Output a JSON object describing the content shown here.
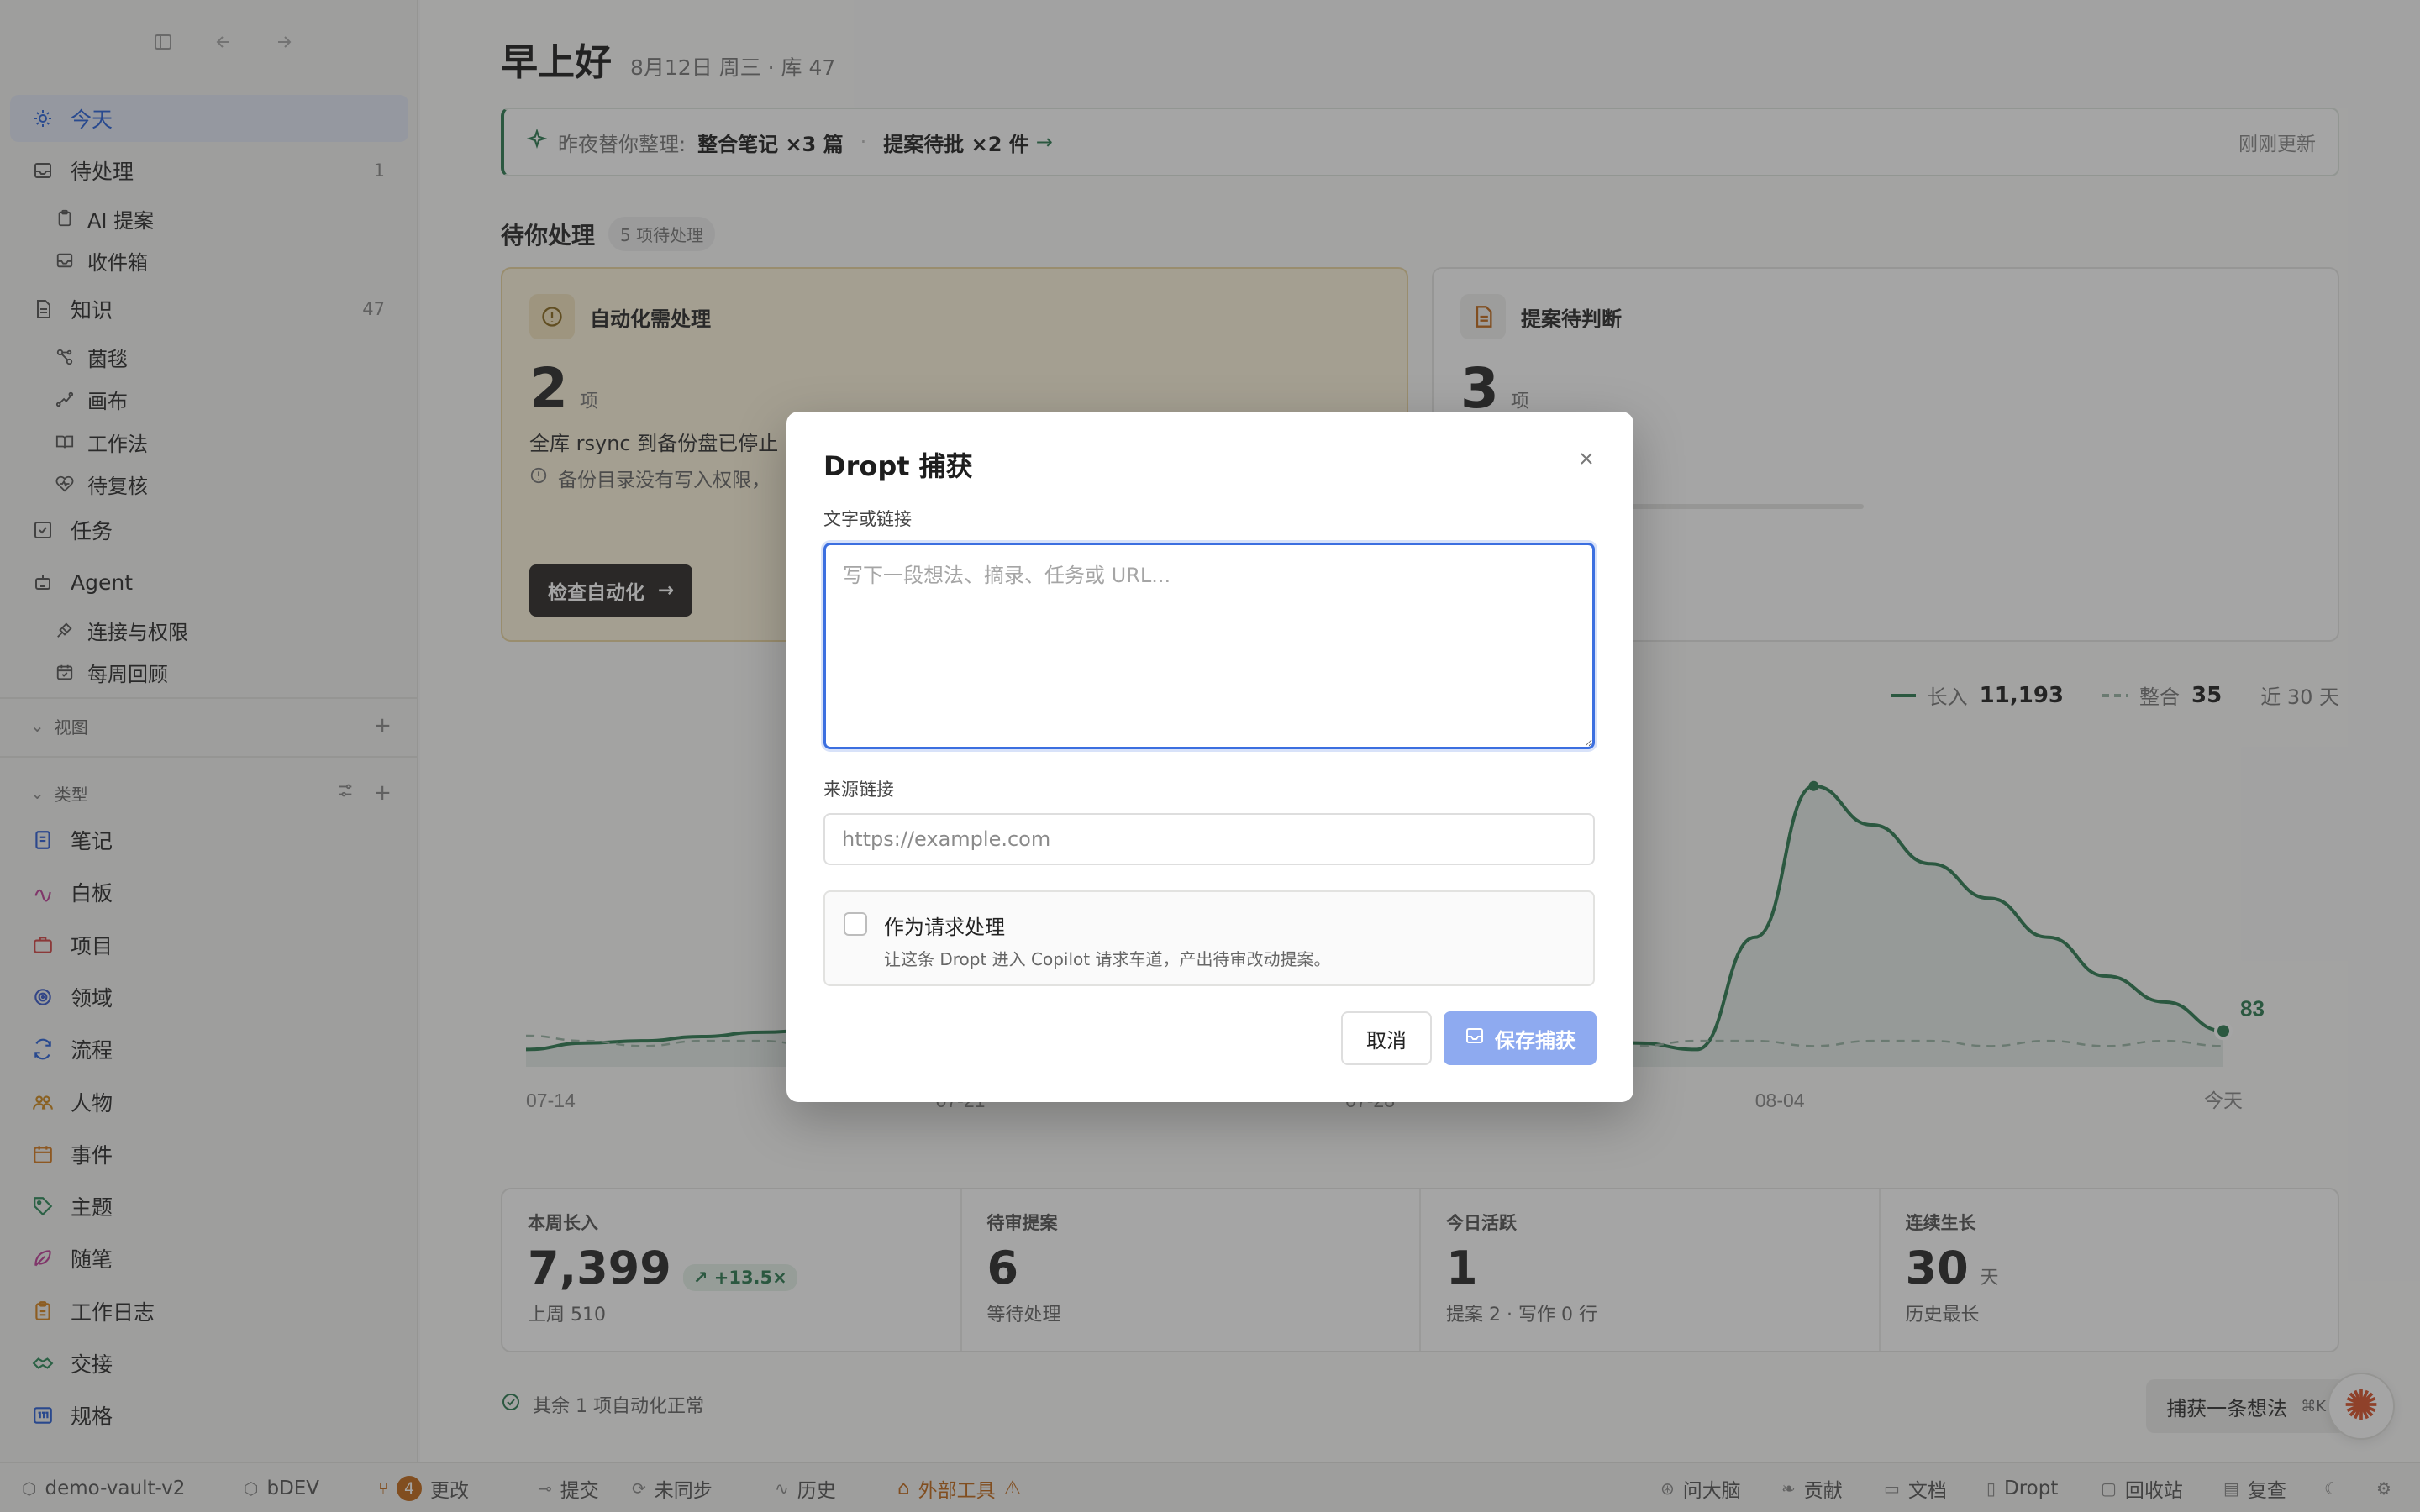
{
  "sidebar": {
    "items": [
      {
        "label": "今天",
        "count": ""
      },
      {
        "label": "待处理",
        "count": "1"
      },
      {
        "label": "AI 提案",
        "count": ""
      },
      {
        "label": "收件箱",
        "count": ""
      },
      {
        "label": "知识",
        "count": "47"
      },
      {
        "label": "菌毯",
        "count": ""
      },
      {
        "label": "画布",
        "count": ""
      },
      {
        "label": "工作法",
        "count": ""
      },
      {
        "label": "待复核",
        "count": ""
      },
      {
        "label": "任务",
        "count": ""
      },
      {
        "label": "Agent",
        "count": ""
      },
      {
        "label": "连接与权限",
        "count": ""
      },
      {
        "label": "每周回顾",
        "count": ""
      }
    ],
    "views_label": "视图",
    "types_label": "类型",
    "types": [
      {
        "label": "笔记",
        "color": "#2f5fd6"
      },
      {
        "label": "白板",
        "color": "#c0409a"
      },
      {
        "label": "项目",
        "color": "#d34545"
      },
      {
        "label": "领域",
        "color": "#3b5ccc"
      },
      {
        "label": "流程",
        "color": "#2a62d9"
      },
      {
        "label": "人物",
        "color": "#d08a1e"
      },
      {
        "label": "事件",
        "color": "#d67a1e"
      },
      {
        "label": "主题",
        "color": "#2d8a5a"
      },
      {
        "label": "随笔",
        "color": "#c0409a"
      },
      {
        "label": "工作日志",
        "color": "#d6841e"
      },
      {
        "label": "交接",
        "color": "#2d8a5a"
      },
      {
        "label": "规格",
        "color": "#2a5fd6"
      }
    ]
  },
  "main": {
    "greeting": "早上好",
    "date_line": "8月12日 周三 · 库 47",
    "banner": {
      "label": "昨夜替你整理:",
      "item1": "整合笔记 ×3 篇",
      "item2": "提案待批 ×2 件",
      "updated": "刚刚更新"
    },
    "pending": {
      "title": "待你处理",
      "pill": "5 项待处理"
    },
    "card_auto": {
      "title": "自动化需处理",
      "count": "2",
      "unit": "项",
      "line1": "全库 rsync 到备份盘已停止",
      "line2": "备份目录没有写入权限，",
      "button": "检查自动化"
    },
    "card_prop": {
      "title": "提案待判断",
      "count": "3",
      "unit": "项",
      "progress": 0.16
    },
    "legend": {
      "in_label": "长入",
      "in_value": "11,193",
      "merge_label": "整合",
      "merge_value": "35",
      "range": "近 30 天"
    },
    "stats": [
      {
        "title": "本周长入",
        "value": "7,399",
        "trend": "+13.5×",
        "unit": "",
        "sub": "上周 510"
      },
      {
        "title": "待审提案",
        "value": "6",
        "trend": "",
        "unit": "",
        "sub": "等待处理"
      },
      {
        "title": "今日活跃",
        "value": "1",
        "trend": "",
        "unit": "",
        "sub": "提案 2 · 写作 0 行"
      },
      {
        "title": "连续生长",
        "value": "30",
        "trend": "",
        "unit": "天",
        "sub": "历史最长"
      }
    ],
    "auto_ok": "其余 1 项自动化正常",
    "capture_button": "捕获一条想法",
    "capture_kbd": "⌘K"
  },
  "chart_data": {
    "type": "line",
    "x": [
      "07-14",
      "07-15",
      "07-16",
      "07-17",
      "07-18",
      "07-19",
      "07-20",
      "07-21",
      "07-22",
      "07-23",
      "07-24",
      "07-25",
      "07-26",
      "07-27",
      "07-28",
      "07-29",
      "07-30",
      "07-31",
      "08-01",
      "08-02",
      "08-03",
      "08-04",
      "08-05",
      "08-06",
      "08-07",
      "08-08",
      "08-09",
      "08-10",
      "08-11",
      "今天"
    ],
    "tick_labels": [
      "07-14",
      "07-21",
      "07-28",
      "08-04",
      "今天"
    ],
    "series": [
      {
        "name": "长入",
        "values": [
          40,
          55,
          60,
          70,
          80,
          85,
          75,
          70,
          72,
          60,
          55,
          60,
          65,
          70,
          60,
          50,
          45,
          60,
          65,
          55,
          40,
          300,
          650,
          560,
          470,
          390,
          300,
          210,
          150,
          83
        ]
      },
      {
        "name": "整合",
        "values": [
          6,
          5,
          4,
          5,
          5,
          4,
          5,
          4,
          5,
          5,
          4,
          5,
          4,
          5,
          4,
          5,
          5,
          4,
          5,
          4,
          5,
          5,
          4,
          5,
          5,
          4,
          5,
          4,
          5,
          4
        ]
      }
    ],
    "end_label": "83",
    "color": "#2d7a52"
  },
  "statusbar": {
    "vault": "demo-vault-v2",
    "branch": "bDEV",
    "changes_count": "4",
    "changes_label": "更改",
    "commit": "提交",
    "unsynced": "未同步",
    "history": "历史",
    "external": "外部工具",
    "brain": "问大脑",
    "contrib": "贡献",
    "docs": "文档",
    "dropt": "Dropt",
    "trash": "回收站",
    "review": "复查"
  },
  "modal": {
    "title": "Dropt 捕获",
    "text_label": "文字或链接",
    "text_placeholder": "写下一段想法、摘录、任务或 URL...",
    "text_value": "",
    "source_label": "来源链接",
    "source_placeholder": "https://example.com",
    "source_value": "",
    "request_title": "作为请求处理",
    "request_desc": "让这条 Dropt 进入 Copilot 请求车道，产出待审改动提案。",
    "cancel": "取消",
    "save": "保存捕获"
  }
}
